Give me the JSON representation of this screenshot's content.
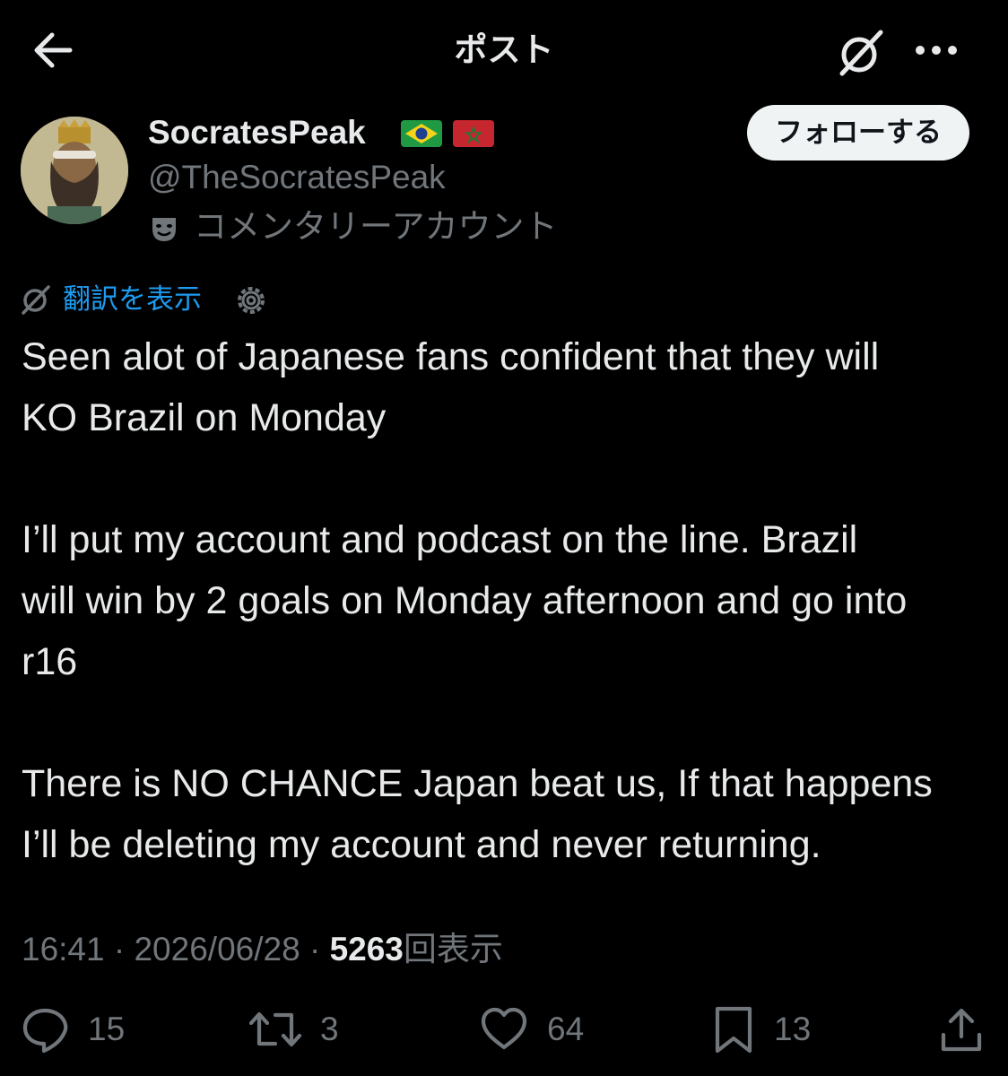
{
  "header": {
    "title": "ポスト"
  },
  "author": {
    "display_name": "SocratesPeak",
    "flags": [
      "brazil-flag-icon",
      "morocco-flag-icon"
    ],
    "handle": "@TheSocratesPeak",
    "account_label": "コメンタリーアカウント",
    "follow_label": "フォローする"
  },
  "translate": {
    "label": "翻訳を表示"
  },
  "tweet": {
    "paragraphs": [
      "Seen alot of Japanese fans confident that they will\nKO Brazil on Monday",
      "I’ll put my account and podcast on the line. Brazil\nwill win by 2 goals on Monday afternoon and go into\nr16",
      "There is NO CHANCE Japan beat us, If that happens\nI’ll be deleting my account and never returning."
    ]
  },
  "meta": {
    "time": "16:41",
    "separator": "·",
    "date": "2026/06/28",
    "views_count": "5263",
    "views_label": "回表示"
  },
  "actions": {
    "replies": "15",
    "reposts": "3",
    "likes": "64",
    "bookmarks": "13"
  },
  "colors": {
    "background": "#000000",
    "text_primary": "#e7e9ea",
    "text_secondary": "#71767b",
    "link": "#1d9bf0",
    "follow_bg": "#eff3f4"
  }
}
